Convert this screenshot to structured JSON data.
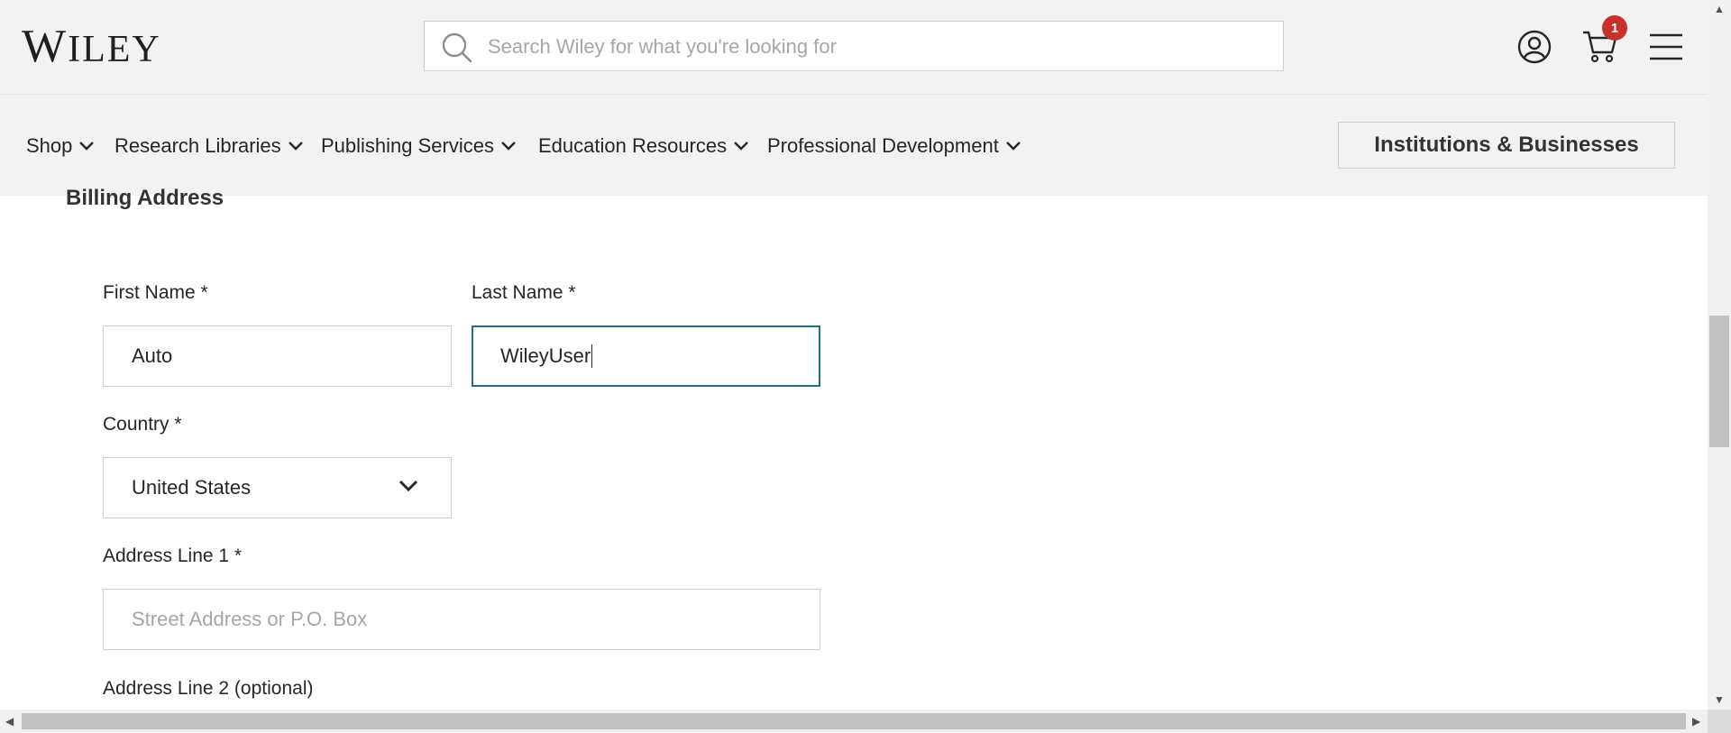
{
  "header": {
    "logo_text": "Wiley",
    "search": {
      "placeholder": "Search Wiley for what you're looking for",
      "value": ""
    },
    "cart_count": "1"
  },
  "nav": {
    "items": [
      {
        "label": "Shop"
      },
      {
        "label": "Research Libraries"
      },
      {
        "label": "Publishing Services"
      },
      {
        "label": "Education Resources"
      },
      {
        "label": "Professional Development"
      }
    ],
    "institutions_button": "Institutions & Businesses"
  },
  "form": {
    "section_title": "Billing Address",
    "first_name": {
      "label": "First Name *",
      "value": "Auto"
    },
    "last_name": {
      "label": "Last Name *",
      "value": "WileyUser"
    },
    "country": {
      "label": "Country *",
      "value": "United States"
    },
    "address1": {
      "label": "Address Line 1 *",
      "placeholder": "Street Address or P.O. Box"
    },
    "address2": {
      "label": "Address Line 2 (optional)"
    }
  },
  "colors": {
    "header_bg": "#f2f2f2",
    "badge": "#c9302c",
    "focus_border": "#1f6f8b"
  },
  "icons": [
    "search-icon",
    "user-icon",
    "cart-icon",
    "hamburger-menu-icon",
    "chevron-down-icon"
  ]
}
